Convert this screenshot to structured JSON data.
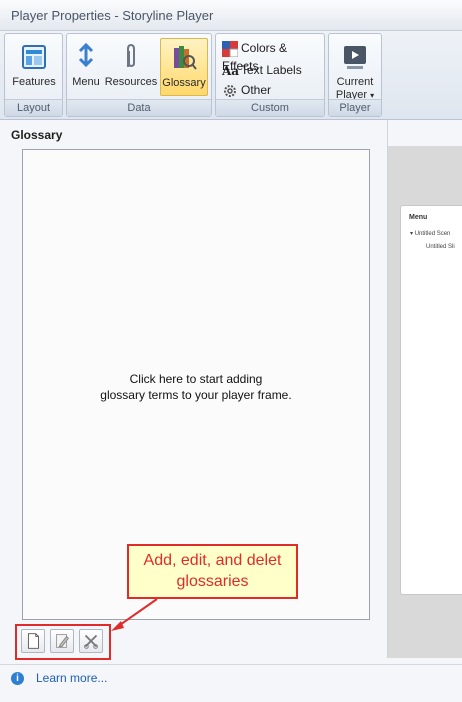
{
  "window": {
    "title": "Player Properties - Storyline Player"
  },
  "ribbon": {
    "layout": {
      "label": "Layout",
      "features": "Features"
    },
    "data": {
      "label": "Data",
      "menu": "Menu",
      "resources": "Resources",
      "glossary": "Glossary"
    },
    "custom": {
      "label": "Custom",
      "colors": "Colors & Effects",
      "text_labels": "Text Labels",
      "other": "Other"
    },
    "player": {
      "label": "Player",
      "current_line1": "Current",
      "current_line2": "Player"
    }
  },
  "glossary": {
    "title": "Glossary",
    "empty_line1": "Click here to start adding",
    "empty_line2": "glossary terms to your player frame."
  },
  "preview": {
    "menu_header": "Menu",
    "scene": "Untitled Scen",
    "slide": "Untitled Sli"
  },
  "callout": {
    "line1": "Add, edit, and delet",
    "line2": "glossaries"
  },
  "footer": {
    "learn_more": "Learn more..."
  },
  "colors": {
    "accent_red": "#e02b2b",
    "active_button": "#ffd86b",
    "link": "#1e5fb8"
  }
}
